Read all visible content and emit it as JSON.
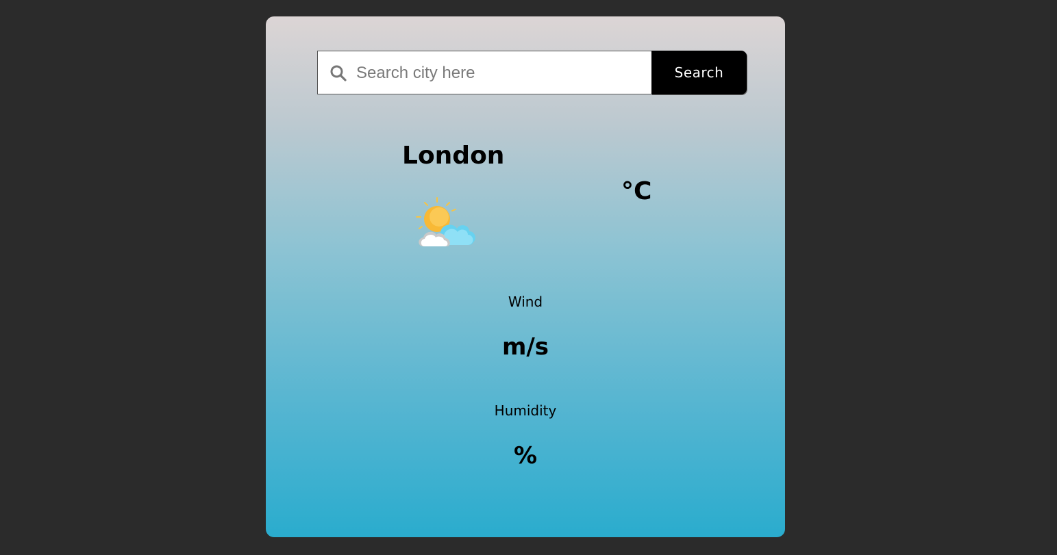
{
  "search": {
    "placeholder": "Search city here",
    "value": "",
    "button_label": "Search",
    "icon": "search-icon"
  },
  "weather": {
    "city": "London",
    "icon": "partly-cloudy-icon",
    "temperature": "°C",
    "wind_label": "Wind",
    "wind_value": "m/s",
    "humidity_label": "Humidity",
    "humidity_value": "%"
  },
  "colors": {
    "page_background": "#2b2b2b",
    "card_gradient_top": "#dcd5d5",
    "card_gradient_bottom": "#2aacce",
    "button_background": "#000000",
    "button_text": "#ffffff"
  }
}
